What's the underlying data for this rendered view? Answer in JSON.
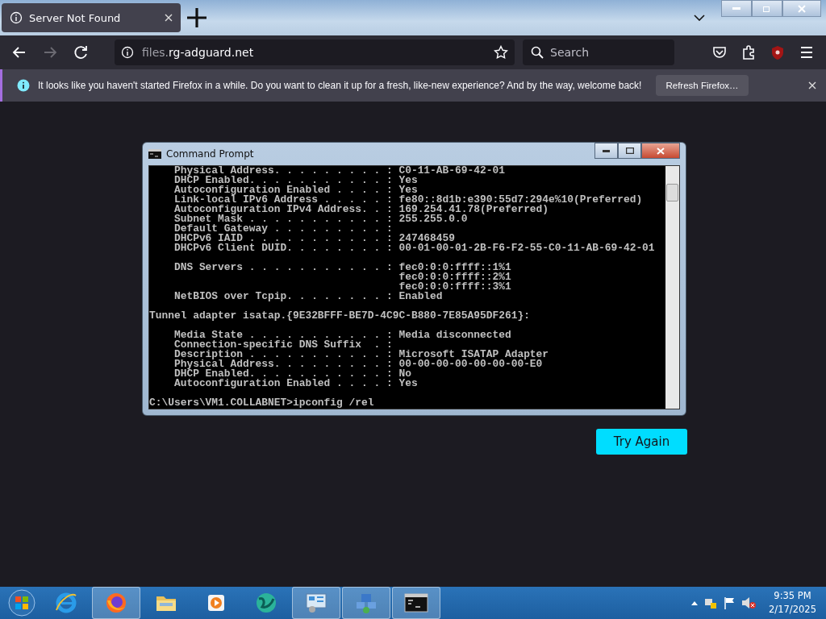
{
  "browser": {
    "tabs": [
      {
        "title": "Server Not Found",
        "selected": true
      }
    ],
    "address": {
      "prefix": "files.",
      "domain": "rg-adguard.net"
    },
    "search": {
      "placeholder": "Search"
    },
    "notification": {
      "text": "It looks like you haven't started Firefox in a while. Do you want to clean it up for a fresh, like-new experience? And by the way, welcome back!",
      "button": "Refresh Firefox…"
    }
  },
  "error_page": {
    "button": "Try Again"
  },
  "command_prompt": {
    "title": "Command Prompt",
    "blocks": [
      [
        "    Physical Address. . . . . . . . . : C0-11-AB-69-42-01",
        "    DHCP Enabled. . . . . . . . . . . : Yes",
        "    Autoconfiguration Enabled . . . . : Yes",
        "    Link-local IPv6 Address . . . . . : fe80::8d1b:e390:55d7:294e%10(Preferred)",
        "    Autoconfiguration IPv4 Address. . : 169.254.41.78(Preferred)",
        "    Subnet Mask . . . . . . . . . . . : 255.255.0.0",
        "    Default Gateway . . . . . . . . . :",
        "    DHCPv6 IAID . . . . . . . . . . . : 247468459",
        "    DHCPv6 Client DUID. . . . . . . . : 00-01-00-01-2B-F6-F2-55-C0-11-AB-69-42-01"
      ],
      [
        "    DNS Servers . . . . . . . . . . . : fec0:0:0:ffff::1%1",
        "                                        fec0:0:0:ffff::2%1",
        "                                        fec0:0:0:ffff::3%1",
        "    NetBIOS over Tcpip. . . . . . . . : Enabled"
      ],
      [
        "Tunnel adapter isatap.{9E32BFFF-BE7D-4C9C-B880-7E85A95DF261}:"
      ],
      [
        "    Media State . . . . . . . . . . . : Media disconnected",
        "    Connection-specific DNS Suffix  . :",
        "    Description . . . . . . . . . . . : Microsoft ISATAP Adapter",
        "    Physical Address. . . . . . . . . : 00-00-00-00-00-00-00-E0",
        "    DHCP Enabled. . . . . . . . . . . : No",
        "    Autoconfiguration Enabled . . . . : Yes"
      ],
      [
        "C:\\Users\\VM1.COLLABNET>ipconfig /rel"
      ]
    ]
  },
  "taskbar": {
    "apps": [
      {
        "kind": "ie",
        "selected": false
      },
      {
        "kind": "firefox",
        "selected": true
      },
      {
        "kind": "folder",
        "selected": false
      },
      {
        "kind": "media",
        "selected": false
      },
      {
        "kind": "globe",
        "selected": false
      },
      {
        "kind": "panel",
        "selected": true
      },
      {
        "kind": "network",
        "selected": true
      },
      {
        "kind": "cmd",
        "selected": true
      }
    ],
    "time": "9:35 PM",
    "date": "2/17/2025"
  }
}
